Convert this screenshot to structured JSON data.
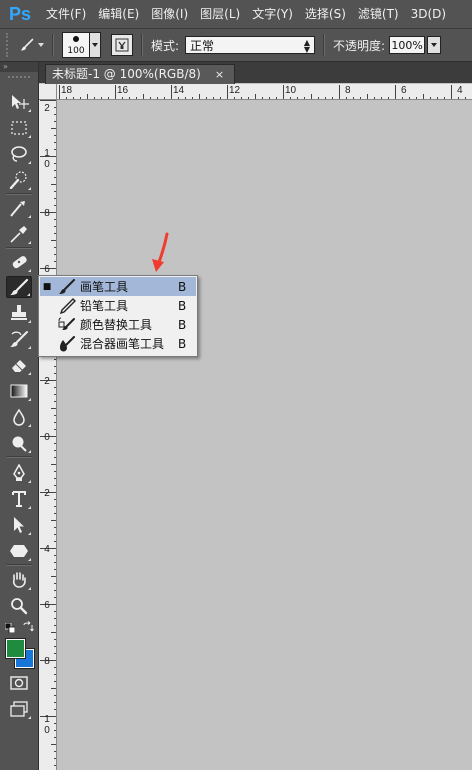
{
  "app": {
    "logo": "Ps"
  },
  "menu": {
    "items": [
      "文件(F)",
      "编辑(E)",
      "图像(I)",
      "图层(L)",
      "文字(Y)",
      "选择(S)",
      "滤镜(T)",
      "3D(D)"
    ]
  },
  "options": {
    "brush_size": "100",
    "mode_label": "模式:",
    "mode_value": "正常",
    "opacity_label": "不透明度:",
    "opacity_value": "100%"
  },
  "toolbox": {
    "header": "»"
  },
  "document": {
    "tab_title": "未标题-1 @ 100%(RGB/8)",
    "close_glyph": "×"
  },
  "rulers": {
    "horizontal": [
      "18",
      "16",
      "14",
      "12",
      "10",
      "8",
      "6",
      "4"
    ],
    "vertical": [
      "2",
      "10",
      "8",
      "6",
      "4",
      "2",
      "0",
      "2",
      "4",
      "6",
      "8",
      "10"
    ]
  },
  "flyout": {
    "items": [
      {
        "label": "画笔工具",
        "shortcut": "B",
        "icon": "brush-icon",
        "selected": true,
        "bullet": "■"
      },
      {
        "label": "铅笔工具",
        "shortcut": "B",
        "icon": "pencil-icon",
        "selected": false,
        "bullet": ""
      },
      {
        "label": "颜色替换工具",
        "shortcut": "B",
        "icon": "color-replacement-icon",
        "selected": false,
        "bullet": ""
      },
      {
        "label": "混合器画笔工具",
        "shortcut": "B",
        "icon": "mixer-brush-icon",
        "selected": false,
        "bullet": ""
      }
    ]
  },
  "colors": {
    "foreground": "#1e8b3e",
    "background": "#1677d8",
    "selection": "#a3b7d9",
    "annotation_arrow": "#f03c2e"
  }
}
